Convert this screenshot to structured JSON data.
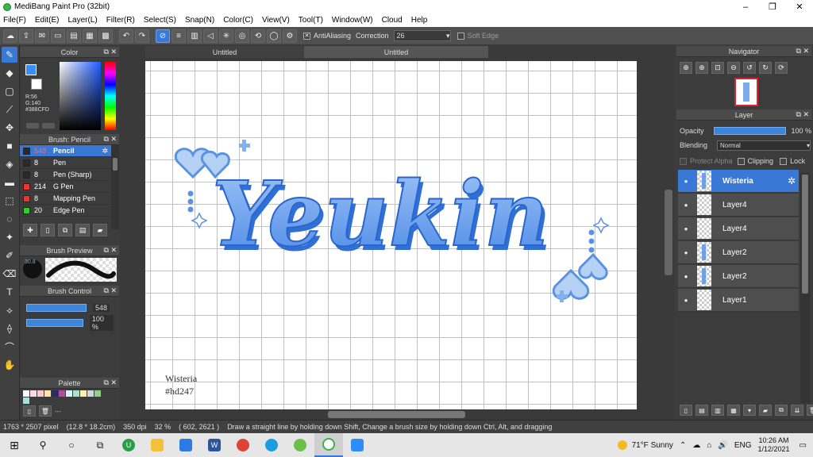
{
  "window": {
    "title": "MediBang Paint Pro (32bit)",
    "minimize": "–",
    "restore": "❐",
    "close": "✕"
  },
  "menu": [
    "File(F)",
    "Edit(E)",
    "Layer(L)",
    "Filter(R)",
    "Select(S)",
    "Snap(N)",
    "Color(C)",
    "View(V)",
    "Tool(T)",
    "Window(W)",
    "Cloud",
    "Help"
  ],
  "toolbar": {
    "antialiasing_label": "AntiAliasing",
    "antialiasing_checked": true,
    "correction_label": "Correction",
    "correction_value": "26",
    "soft_edge_label": "Soft Edge",
    "soft_edge_checked": false
  },
  "color_panel": {
    "title": "Color",
    "r": "R:56",
    "g": "G:140",
    "hex": "#388CFD",
    "foreground": "#388cfd",
    "background": "#ffffff"
  },
  "brush_panel": {
    "title": "Brush: Pencil",
    "items": [
      {
        "size": "548",
        "name": "Pencil",
        "color": "#2a2a2a",
        "selected": true
      },
      {
        "size": "8",
        "name": "Pen",
        "color": "#2a2a2a",
        "selected": false
      },
      {
        "size": "8",
        "name": "Pen (Sharp)",
        "color": "#2a2a2a",
        "selected": false
      },
      {
        "size": "214",
        "name": "G Pen",
        "color": "#ee3333",
        "selected": false
      },
      {
        "size": "8",
        "name": "Mapping Pen",
        "color": "#ee3333",
        "selected": false
      },
      {
        "size": "20",
        "name": "Edge Pen",
        "color": "#33cc33",
        "selected": false
      }
    ]
  },
  "brush_preview": {
    "title": "Brush Preview",
    "size_value": "30.8"
  },
  "brush_control": {
    "title": "Brush Control",
    "size_value": "548",
    "opacity_value": "100 %"
  },
  "palette": {
    "title": "Palette",
    "colors": [
      "#ffffff",
      "#ffd6e6",
      "#f7c6d9",
      "#ffe7a8",
      "#2b2b66",
      "#b44ba0",
      "#d9f0ff",
      "#a8e3c7",
      "#fff2a8",
      "#cfd7e6",
      "#8fd18a",
      "#a3e0e0"
    ],
    "dash": "---"
  },
  "documents": {
    "tab1": "Untitled",
    "tab2": "Untitled"
  },
  "canvas": {
    "artwork_text": "Yeukin",
    "signature_line1": "Wisteria",
    "signature_line2": "#hd247"
  },
  "navigator": {
    "title": "Navigator"
  },
  "layer_panel": {
    "title": "Layer",
    "opacity_label": "Opacity",
    "opacity_value": "100 %",
    "blending_label": "Blending",
    "blending_value": "Normal",
    "protect_alpha": "Protect Alpha",
    "clipping": "Clipping",
    "lock": "Lock",
    "layers": [
      {
        "name": "Wisteria",
        "selected": true,
        "art": true
      },
      {
        "name": "Layer4",
        "selected": false,
        "art": false
      },
      {
        "name": "Layer4",
        "selected": false,
        "art": false
      },
      {
        "name": "Layer2",
        "selected": false,
        "art": true
      },
      {
        "name": "Layer2",
        "selected": false,
        "art": true
      },
      {
        "name": "Layer1",
        "selected": false,
        "art": false
      }
    ]
  },
  "status": {
    "dimensions": "1763 * 2507 pixel",
    "physical": "(12.8 * 18.2cm)",
    "dpi": "350 dpi",
    "zoom": "32 %",
    "cursor": "( 602, 2621 )",
    "hint": "Draw a straight line by holding down Shift, Change a brush size by holding down Ctrl, Alt, and dragging"
  },
  "taskbar": {
    "weather": "71°F  Sunny",
    "language": "ENG",
    "time": "10:26 AM",
    "date": "1/12/2021"
  }
}
